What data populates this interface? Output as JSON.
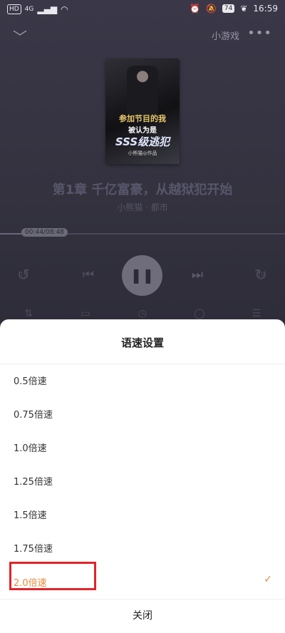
{
  "status_bar": {
    "left_icons": [
      "HD",
      "4G",
      "signal-icon",
      "wifi-icon"
    ],
    "battery": "74",
    "time": "16:59"
  },
  "header": {
    "mini_game_label": "小游戏"
  },
  "book": {
    "cover_text": [
      "参加节目的我",
      "被认为是",
      "SSS级逃犯",
      "小熊猫◎作品"
    ],
    "chapter_title": "第1章 千亿富豪，从越狱犯开始",
    "author_line": "小熊猫 · 都市",
    "progress": "00:44/08:48",
    "progress_fraction": 0.083
  },
  "controls": {
    "rewind_seconds": "15",
    "forward_seconds": "15"
  },
  "speed_sheet": {
    "title": "语速设置",
    "options": [
      {
        "label": "0.5倍速",
        "selected": false
      },
      {
        "label": "0.75倍速",
        "selected": false
      },
      {
        "label": "1.0倍速",
        "selected": false
      },
      {
        "label": "1.25倍速",
        "selected": false
      },
      {
        "label": "1.5倍速",
        "selected": false
      },
      {
        "label": "1.75倍速",
        "selected": false
      },
      {
        "label": "2.0倍速",
        "selected": true
      }
    ],
    "close_label": "关闭",
    "accent_color": "#e7893e"
  }
}
